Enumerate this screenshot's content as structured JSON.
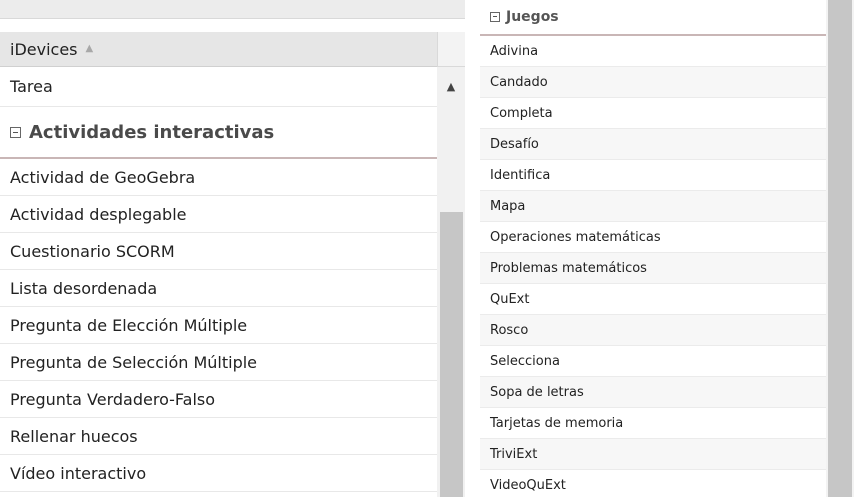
{
  "left": {
    "header_label": "iDevices",
    "sort_icon": "▲",
    "scroll_up_icon": "▲",
    "first_item": "Tarea",
    "group_title": "Actividades interactivas",
    "items": [
      "Actividad de GeoGebra",
      "Actividad desplegable",
      "Cuestionario SCORM",
      "Lista desordenada",
      "Pregunta de Elección Múltiple",
      "Pregunta de Selección Múltiple",
      "Pregunta Verdadero-Falso",
      "Rellenar huecos",
      "Vídeo interactivo"
    ]
  },
  "right": {
    "group_title": "Juegos",
    "items": [
      "Adivina",
      "Candado",
      "Completa",
      "Desafío",
      "Identifica",
      "Mapa",
      "Operaciones matemáticas",
      "Problemas matemáticos",
      "QuExt",
      "Rosco",
      "Selecciona",
      "Sopa de letras",
      "Tarjetas de memoria",
      "TriviExt",
      "VideoQuExt"
    ]
  },
  "colors": {
    "header_bg": "#e6e6e6",
    "group_underline": "#c9b6b6",
    "scroll_thumb": "#c6c6c6"
  }
}
